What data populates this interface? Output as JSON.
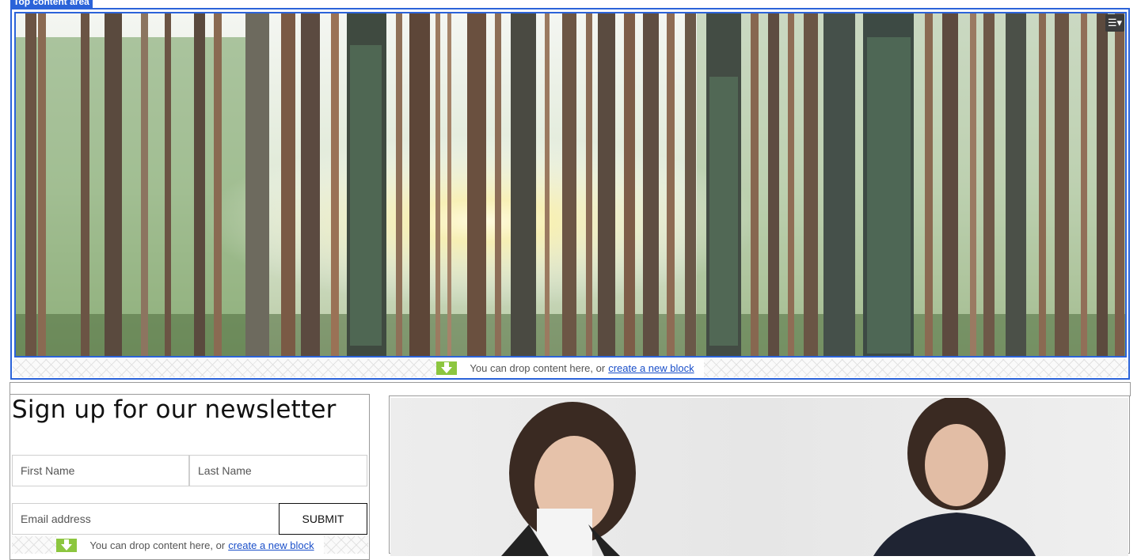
{
  "top_area": {
    "label": "Top content area",
    "menu_icon": "menu-icon",
    "hero_image_alt": "forest-photo"
  },
  "top_drop": {
    "text": "You can drop content here, or",
    "link": "create a new block"
  },
  "newsletter": {
    "title": "Sign up for our newsletter",
    "first_name_placeholder": "First Name",
    "last_name_placeholder": "Last Name",
    "email_placeholder": "Email address",
    "submit_label": "SUBMIT"
  },
  "newsletter_drop": {
    "text": "You can drop content here, or",
    "link": "create a new block"
  },
  "colors": {
    "selection": "#2b63d9",
    "drop_arrow": "#8cc63f",
    "link": "#1a4fc9"
  }
}
